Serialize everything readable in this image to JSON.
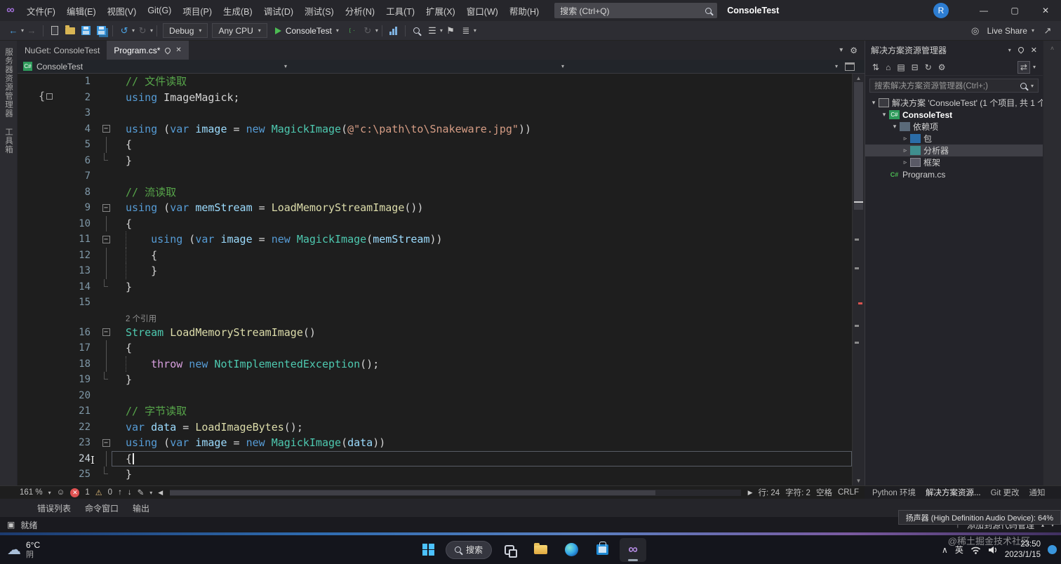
{
  "titlebar": {
    "menus": [
      "文件(F)",
      "编辑(E)",
      "视图(V)",
      "Git(G)",
      "项目(P)",
      "生成(B)",
      "调试(D)",
      "测试(S)",
      "分析(N)",
      "工具(T)",
      "扩展(X)",
      "窗口(W)",
      "帮助(H)"
    ],
    "search_text": "搜索 (Ctrl+Q)",
    "window_title": "ConsoleTest",
    "account_initial": "R"
  },
  "toolbar": {
    "config": "Debug",
    "platform": "Any CPU",
    "run_target": "ConsoleTest",
    "live_share_label": "Live Share"
  },
  "editor_tabs": [
    {
      "label": "NuGet: ConsoleTest",
      "active": false
    },
    {
      "label": "Program.cs*",
      "active": true
    }
  ],
  "breadcrumb": {
    "project": "ConsoleTest"
  },
  "left_dock_tabs": [
    "服务器资源管理器",
    "工具箱"
  ],
  "editor": {
    "rows": [
      {
        "n": "1",
        "f": "",
        "t": [
          [
            "cm",
            "// 文件读取"
          ]
        ]
      },
      {
        "n": "2",
        "f": "",
        "t": [
          [
            "kw",
            "using"
          ],
          [
            "pl",
            " ImageMagick;"
          ]
        ]
      },
      {
        "n": "3",
        "f": "",
        "t": []
      },
      {
        "n": "4",
        "f": "+",
        "t": [
          [
            "kw",
            "using"
          ],
          [
            "pl",
            " ("
          ],
          [
            "kw",
            "var"
          ],
          [
            "pl",
            " "
          ],
          [
            "lv",
            "image"
          ],
          [
            "pl",
            " = "
          ],
          [
            "kw",
            "new"
          ],
          [
            "pl",
            " "
          ],
          [
            "ty",
            "MagickImage"
          ],
          [
            "pl",
            "("
          ],
          [
            "st",
            "@\"c:\\path\\to\\Snakeware.jpg\""
          ],
          [
            "pl",
            "))"
          ]
        ]
      },
      {
        "n": "5",
        "f": "|",
        "t": [
          [
            "pl",
            "{"
          ]
        ]
      },
      {
        "n": "6",
        "f": "L",
        "t": [
          [
            "pl",
            "}"
          ]
        ]
      },
      {
        "n": "7",
        "f": "",
        "t": []
      },
      {
        "n": "8",
        "f": "",
        "t": [
          [
            "cm",
            "// 流读取"
          ]
        ]
      },
      {
        "n": "9",
        "f": "+",
        "t": [
          [
            "kw",
            "using"
          ],
          [
            "pl",
            " ("
          ],
          [
            "kw",
            "var"
          ],
          [
            "pl",
            " "
          ],
          [
            "lv",
            "memStream"
          ],
          [
            "pl",
            " = "
          ],
          [
            "me",
            "LoadMemoryStreamImage"
          ],
          [
            "pl",
            "())"
          ]
        ]
      },
      {
        "n": "10",
        "f": "|",
        "t": [
          [
            "pl",
            "{"
          ]
        ]
      },
      {
        "n": "11",
        "f": "+",
        "t": [
          [
            "gd",
            ""
          ],
          [
            "pl",
            "   "
          ],
          [
            "kw",
            "using"
          ],
          [
            "pl",
            " ("
          ],
          [
            "kw",
            "var"
          ],
          [
            "pl",
            " "
          ],
          [
            "lv",
            "image"
          ],
          [
            "pl",
            " = "
          ],
          [
            "kw",
            "new"
          ],
          [
            "pl",
            " "
          ],
          [
            "ty",
            "MagickImage"
          ],
          [
            "pl",
            "("
          ],
          [
            "lv",
            "memStream"
          ],
          [
            "pl",
            "))"
          ]
        ]
      },
      {
        "n": "12",
        "f": "|",
        "t": [
          [
            "gd",
            ""
          ],
          [
            "pl",
            "   {"
          ]
        ]
      },
      {
        "n": "13",
        "f": "|",
        "t": [
          [
            "gd",
            ""
          ],
          [
            "pl",
            "   }"
          ]
        ]
      },
      {
        "n": "14",
        "f": "L",
        "t": [
          [
            "pl",
            "}"
          ]
        ]
      },
      {
        "n": "15",
        "f": "",
        "t": []
      },
      {
        "lens": "2 个引用"
      },
      {
        "n": "16",
        "f": "+",
        "t": [
          [
            "ty",
            "Stream"
          ],
          [
            "pl",
            " "
          ],
          [
            "me",
            "LoadMemoryStreamImage"
          ],
          [
            "pl",
            "()"
          ]
        ]
      },
      {
        "n": "17",
        "f": "|",
        "t": [
          [
            "pl",
            "{"
          ]
        ]
      },
      {
        "n": "18",
        "f": "|",
        "t": [
          [
            "gd",
            ""
          ],
          [
            "pl",
            "   "
          ],
          [
            "ct",
            "throw"
          ],
          [
            "pl",
            " "
          ],
          [
            "kw",
            "new"
          ],
          [
            "pl",
            " "
          ],
          [
            "ty",
            "NotImplementedException"
          ],
          [
            "pl",
            "();"
          ]
        ]
      },
      {
        "n": "19",
        "f": "L",
        "t": [
          [
            "pl",
            "}"
          ]
        ]
      },
      {
        "n": "20",
        "f": "",
        "t": []
      },
      {
        "n": "21",
        "f": "",
        "t": [
          [
            "cm",
            "// 字节读取"
          ]
        ]
      },
      {
        "n": "22",
        "f": "",
        "t": [
          [
            "kw",
            "var"
          ],
          [
            "pl",
            " "
          ],
          [
            "lv",
            "data"
          ],
          [
            "pl",
            " = "
          ],
          [
            "me",
            "LoadImageBytes"
          ],
          [
            "pl",
            "();"
          ]
        ]
      },
      {
        "n": "23",
        "f": "+",
        "t": [
          [
            "kw",
            "using"
          ],
          [
            "pl",
            " ("
          ],
          [
            "kw",
            "var"
          ],
          [
            "pl",
            " "
          ],
          [
            "lv",
            "image"
          ],
          [
            "pl",
            " = "
          ],
          [
            "kw",
            "new"
          ],
          [
            "pl",
            " "
          ],
          [
            "ty",
            "MagickImage"
          ],
          [
            "pl",
            "("
          ],
          [
            "lv",
            "data"
          ],
          [
            "pl",
            "))"
          ]
        ]
      },
      {
        "n": "24",
        "f": "|",
        "cur": true,
        "t": [
          [
            "pl",
            "{"
          ]
        ]
      },
      {
        "n": "25",
        "f": "L",
        "t": [
          [
            "pl",
            "}"
          ]
        ]
      }
    ],
    "status": {
      "zoom": "161 %",
      "errors": "1",
      "warnings": "0",
      "line": "行: 24",
      "column": "字符: 2",
      "spaces": "空格",
      "line_ending": "CRLF"
    }
  },
  "solution_explorer": {
    "title": "解决方案资源管理器",
    "search_placeholder": "搜索解决方案资源管理器(Ctrl+;)",
    "tree": [
      {
        "indent": 0,
        "arrow": "exp",
        "icon": "solution",
        "glyph": "",
        "label": "解决方案 'ConsoleTest' (1 个项目, 共 1 个)"
      },
      {
        "indent": 1,
        "arrow": "exp",
        "icon": "csproj",
        "glyph": "C#",
        "label": "ConsoleTest",
        "bold": true
      },
      {
        "indent": 2,
        "arrow": "exp",
        "icon": "deps",
        "glyph": "",
        "label": "依赖项"
      },
      {
        "indent": 3,
        "arrow": "col",
        "icon": "pkg",
        "glyph": "",
        "label": "包"
      },
      {
        "indent": 3,
        "arrow": "col",
        "icon": "analyzer",
        "glyph": "",
        "label": "分析器",
        "selected": true
      },
      {
        "indent": 3,
        "arrow": "col",
        "icon": "framework",
        "glyph": "",
        "label": "框架"
      },
      {
        "indent": 1,
        "arrow": "none",
        "icon": "cs",
        "glyph": "C#",
        "label": "Program.cs"
      }
    ]
  },
  "right_dock_tabs": [
    "Python 环境",
    "解决方案资源...",
    "Git 更改",
    "通知"
  ],
  "bottom_panel_tabs": [
    "错误列表",
    "命令窗口",
    "输出"
  ],
  "statusbar": {
    "ready": "就绪",
    "source_control": "添加到源代码管理"
  },
  "toast_text": "扬声器 (High Definition Audio Device): 64%",
  "taskbar": {
    "weather_temp": "6°C",
    "weather_cond": "阴",
    "search_label": "搜索",
    "ime": "英",
    "time": "23:50",
    "date": "2023/1/15"
  },
  "watermark": "@稀土掘金技术社区"
}
